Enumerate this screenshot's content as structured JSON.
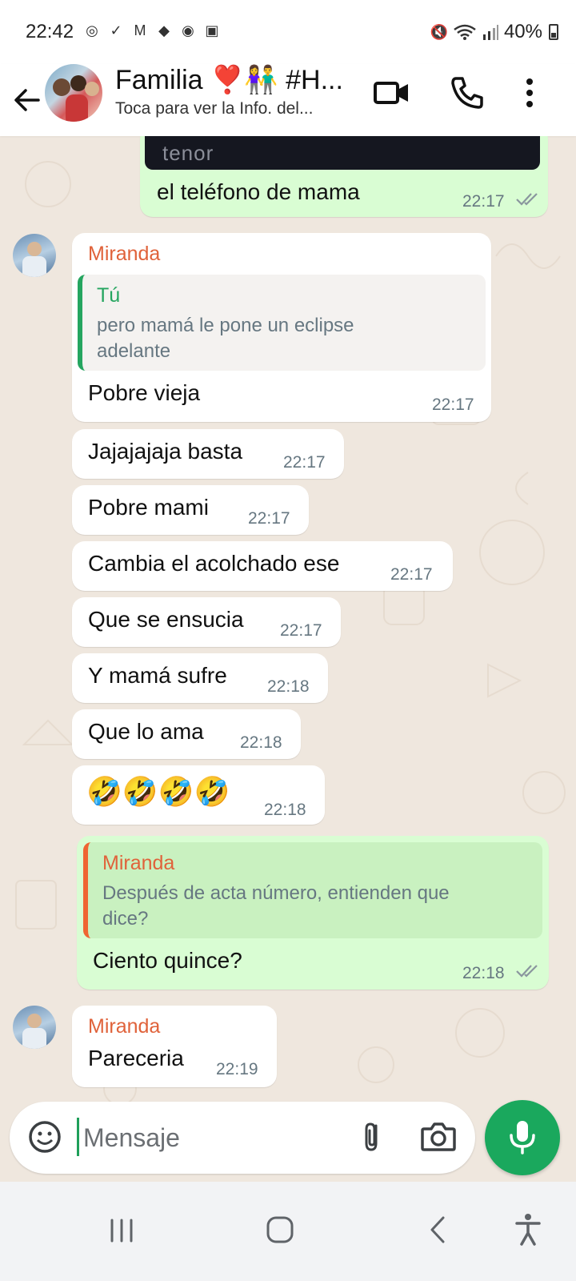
{
  "status_bar": {
    "time": "22:42",
    "battery": "40%",
    "left_icons": [
      "eye-comfort-icon",
      "check-circle-icon",
      "gmail-icon",
      "diamond-nav-icon",
      "camera-app-icon",
      "gallery-icon"
    ],
    "right_icons": [
      "mute-icon",
      "wifi-icon",
      "signal-icon",
      "battery-icon"
    ]
  },
  "header": {
    "title": "Familia ❣️👫 #H...",
    "subtitle": "Toca para ver la Info. del..."
  },
  "gif": {
    "provider": "tenor"
  },
  "messages": [
    {
      "id": "m0",
      "direction": "out",
      "text": "el teléfono de mama",
      "time": "22:17",
      "status": "read"
    },
    {
      "id": "m1",
      "direction": "in",
      "sender": "Miranda",
      "quote": {
        "author": "Tú",
        "text_line1": "pero mamá le pone un eclipse",
        "text_line2": "adelante"
      },
      "text": "Pobre vieja",
      "time": "22:17"
    },
    {
      "id": "m2",
      "direction": "in",
      "text": "Jajajajaja basta",
      "time": "22:17"
    },
    {
      "id": "m3",
      "direction": "in",
      "text": "Pobre mami",
      "time": "22:17"
    },
    {
      "id": "m4",
      "direction": "in",
      "text": "Cambia el acolchado ese",
      "time": "22:17"
    },
    {
      "id": "m5",
      "direction": "in",
      "text": "Que se ensucia",
      "time": "22:17"
    },
    {
      "id": "m6",
      "direction": "in",
      "text": "Y mamá sufre",
      "time": "22:18"
    },
    {
      "id": "m7",
      "direction": "in",
      "text": "Que lo ama",
      "time": "22:18"
    },
    {
      "id": "m8",
      "direction": "in",
      "text": "🤣🤣🤣🤣",
      "time": "22:18"
    },
    {
      "id": "m9",
      "direction": "out",
      "quote": {
        "author": "Miranda",
        "text_line1": "Después de acta número, entienden que",
        "text_line2": "dice?"
      },
      "text": "Ciento quince?",
      "time": "22:18",
      "status": "read"
    },
    {
      "id": "m10",
      "direction": "in",
      "sender": "Miranda",
      "text": "Pareceria",
      "time": "22:19"
    }
  ],
  "input": {
    "placeholder": "Mensaje"
  },
  "colors": {
    "accent_green": "#1aa85d",
    "outgoing_bubble": "#d9fdd3",
    "sender_orange": "#e0623a",
    "quote_bar_green": "#25a55f",
    "chat_background": "#efe7de"
  }
}
